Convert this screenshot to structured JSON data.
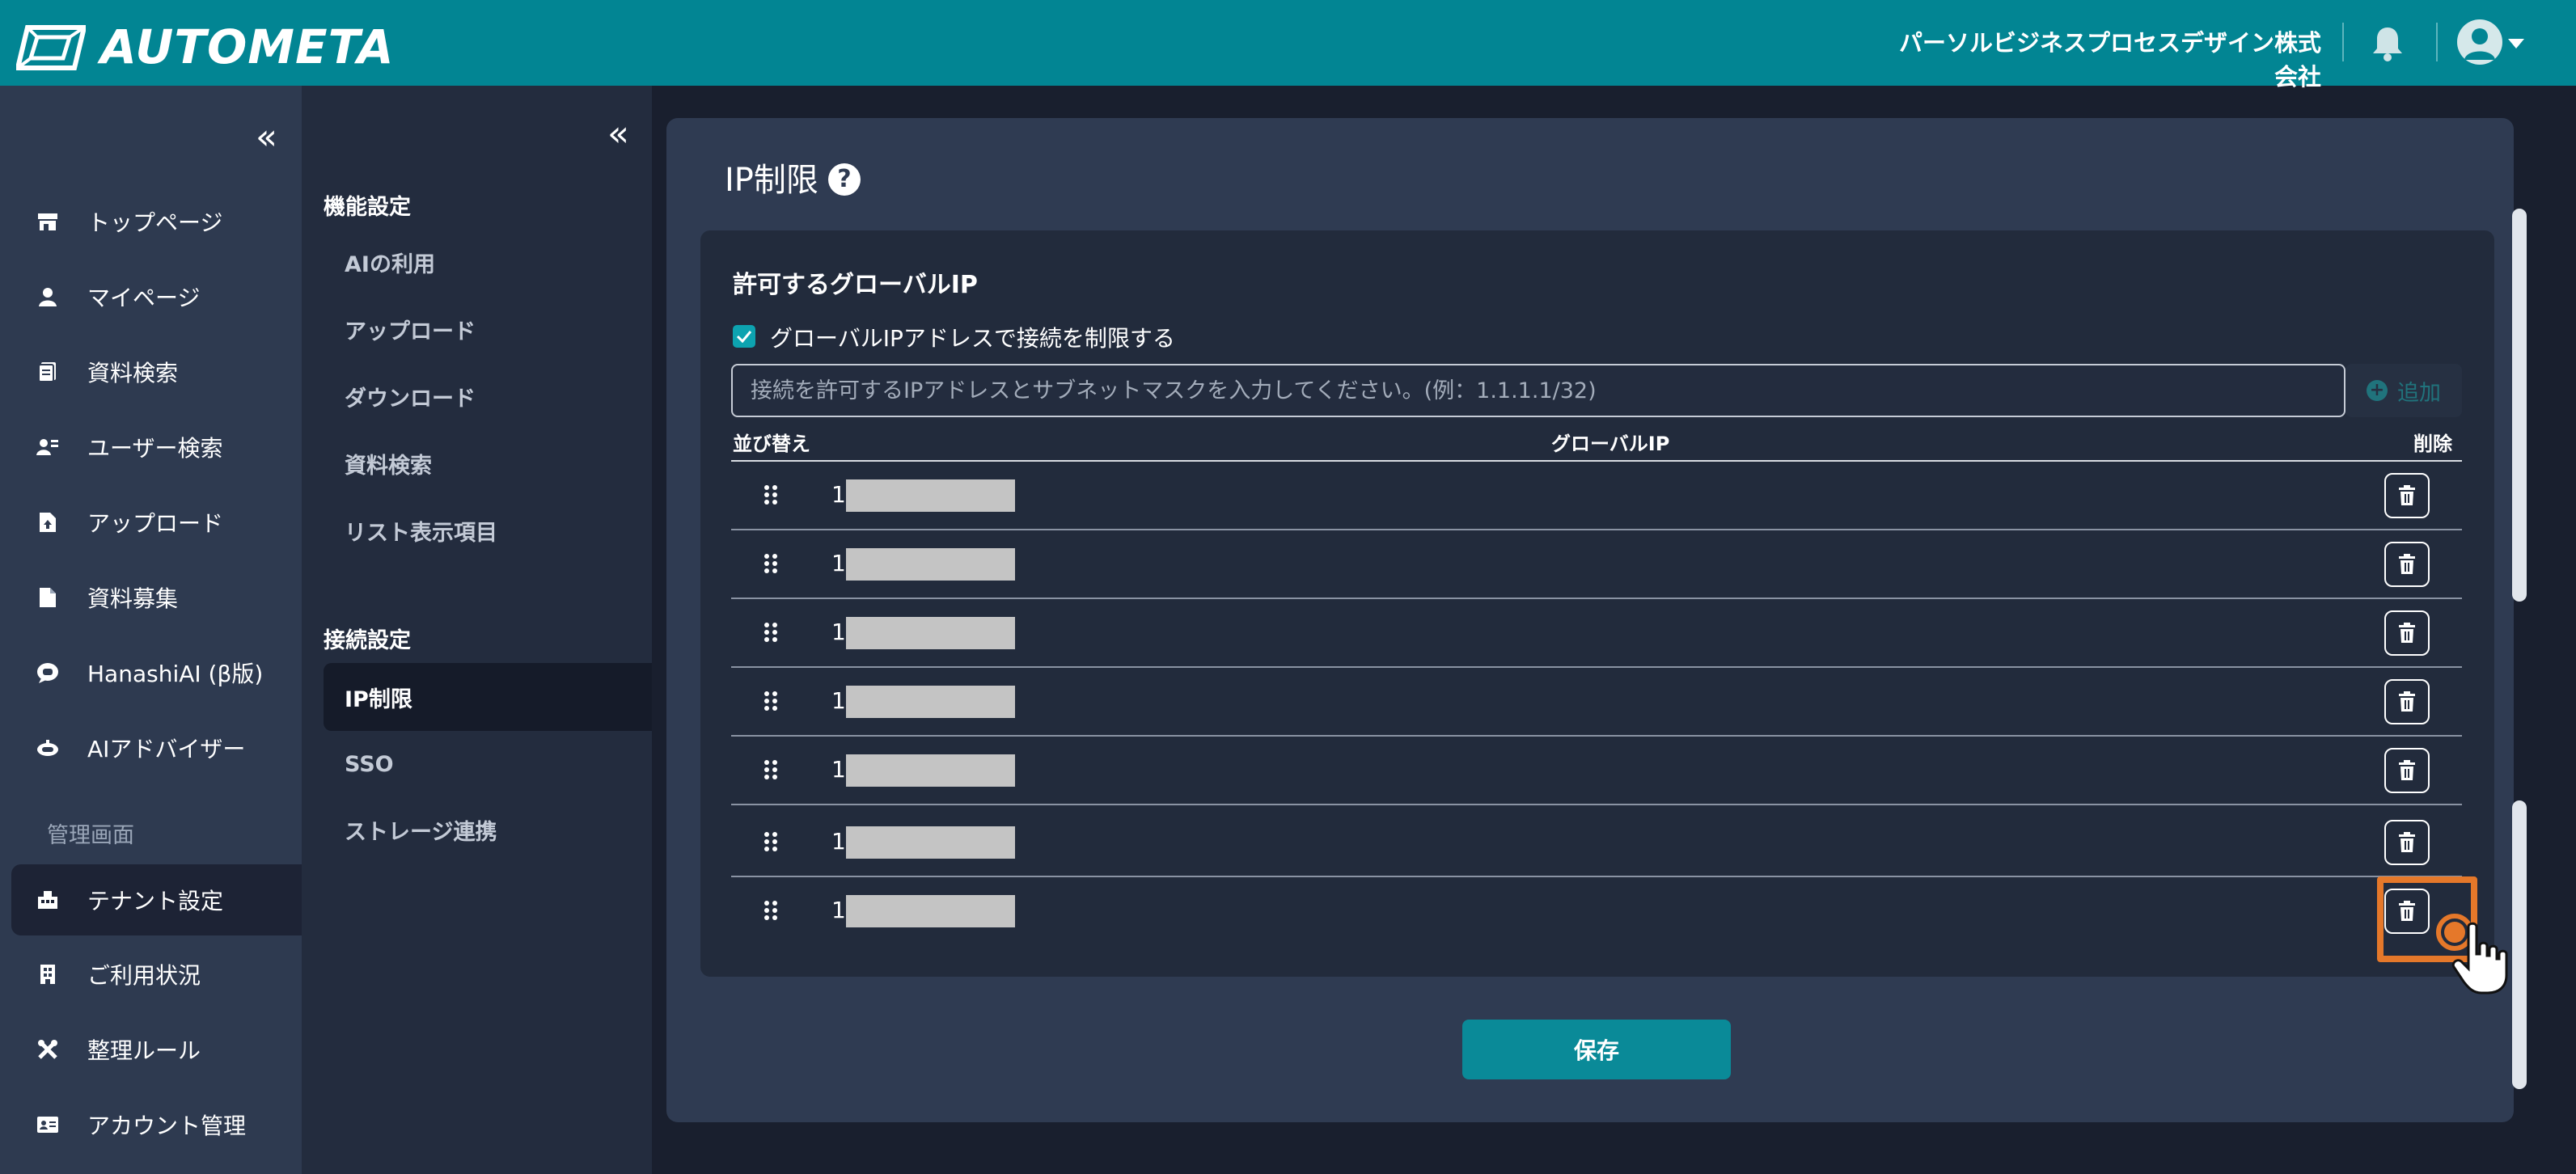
{
  "header": {
    "logo_text": "AUTOMETA",
    "company": "パーソルビジネスプロセスデザイン株式会社",
    "bg_color": "#028593"
  },
  "leftnav": {
    "collapse_glyph": "«",
    "items": [
      {
        "label": "トップページ",
        "icon": "store-icon"
      },
      {
        "label": "マイページ",
        "icon": "person-icon"
      },
      {
        "label": "資料検索",
        "icon": "document-search-icon"
      },
      {
        "label": "ユーザー検索",
        "icon": "user-search-icon"
      },
      {
        "label": "アップロード",
        "icon": "file-upload-icon"
      },
      {
        "label": "資料募集",
        "icon": "file-icon"
      },
      {
        "label": "HanashiAI (β版)",
        "icon": "chat-ai-icon"
      },
      {
        "label": "AIアドバイザー",
        "icon": "robot-icon"
      }
    ],
    "section_label": "管理画面",
    "admin_items": [
      {
        "label": "テナント設定",
        "icon": "tenant-icon",
        "active": true
      },
      {
        "label": "ご利用状況",
        "icon": "building-icon"
      },
      {
        "label": "整理ルール",
        "icon": "tools-icon"
      },
      {
        "label": "アカウント管理",
        "icon": "id-card-icon"
      }
    ]
  },
  "subnav": {
    "collapse_glyph": "«",
    "feature_heading": "機能設定",
    "feature_items": [
      "AIの利用",
      "アップロード",
      "ダウンロード",
      "資料検索",
      "リスト表示項目"
    ],
    "connection_heading": "接続設定",
    "connection_items": [
      "IP制限",
      "SSO",
      "ストレージ連携"
    ],
    "active_item": "IP制限"
  },
  "main": {
    "title": "IP制限",
    "help_glyph": "?",
    "card_title": "許可するグローバルIP",
    "restrict_checkbox": {
      "label": "グローバルIPアドレスで接続を制限する",
      "checked": true
    },
    "input_placeholder": "接続を許可するIPアドレスとサブネットマスクを入力してください。(例：1.1.1.1/32)",
    "add_label": "追加",
    "columns": {
      "sort": "並び替え",
      "ip": "グローバルIP",
      "delete": "削除"
    },
    "rows": [
      {
        "ip_visible": "1"
      },
      {
        "ip_visible": "1"
      },
      {
        "ip_visible": "1"
      },
      {
        "ip_visible": "1"
      },
      {
        "ip_visible": "1"
      },
      {
        "ip_visible": "1"
      },
      {
        "ip_visible": "1"
      }
    ],
    "save_label": "保存",
    "accent_color": "#0a8a98",
    "highlight_color": "#e5782a"
  }
}
